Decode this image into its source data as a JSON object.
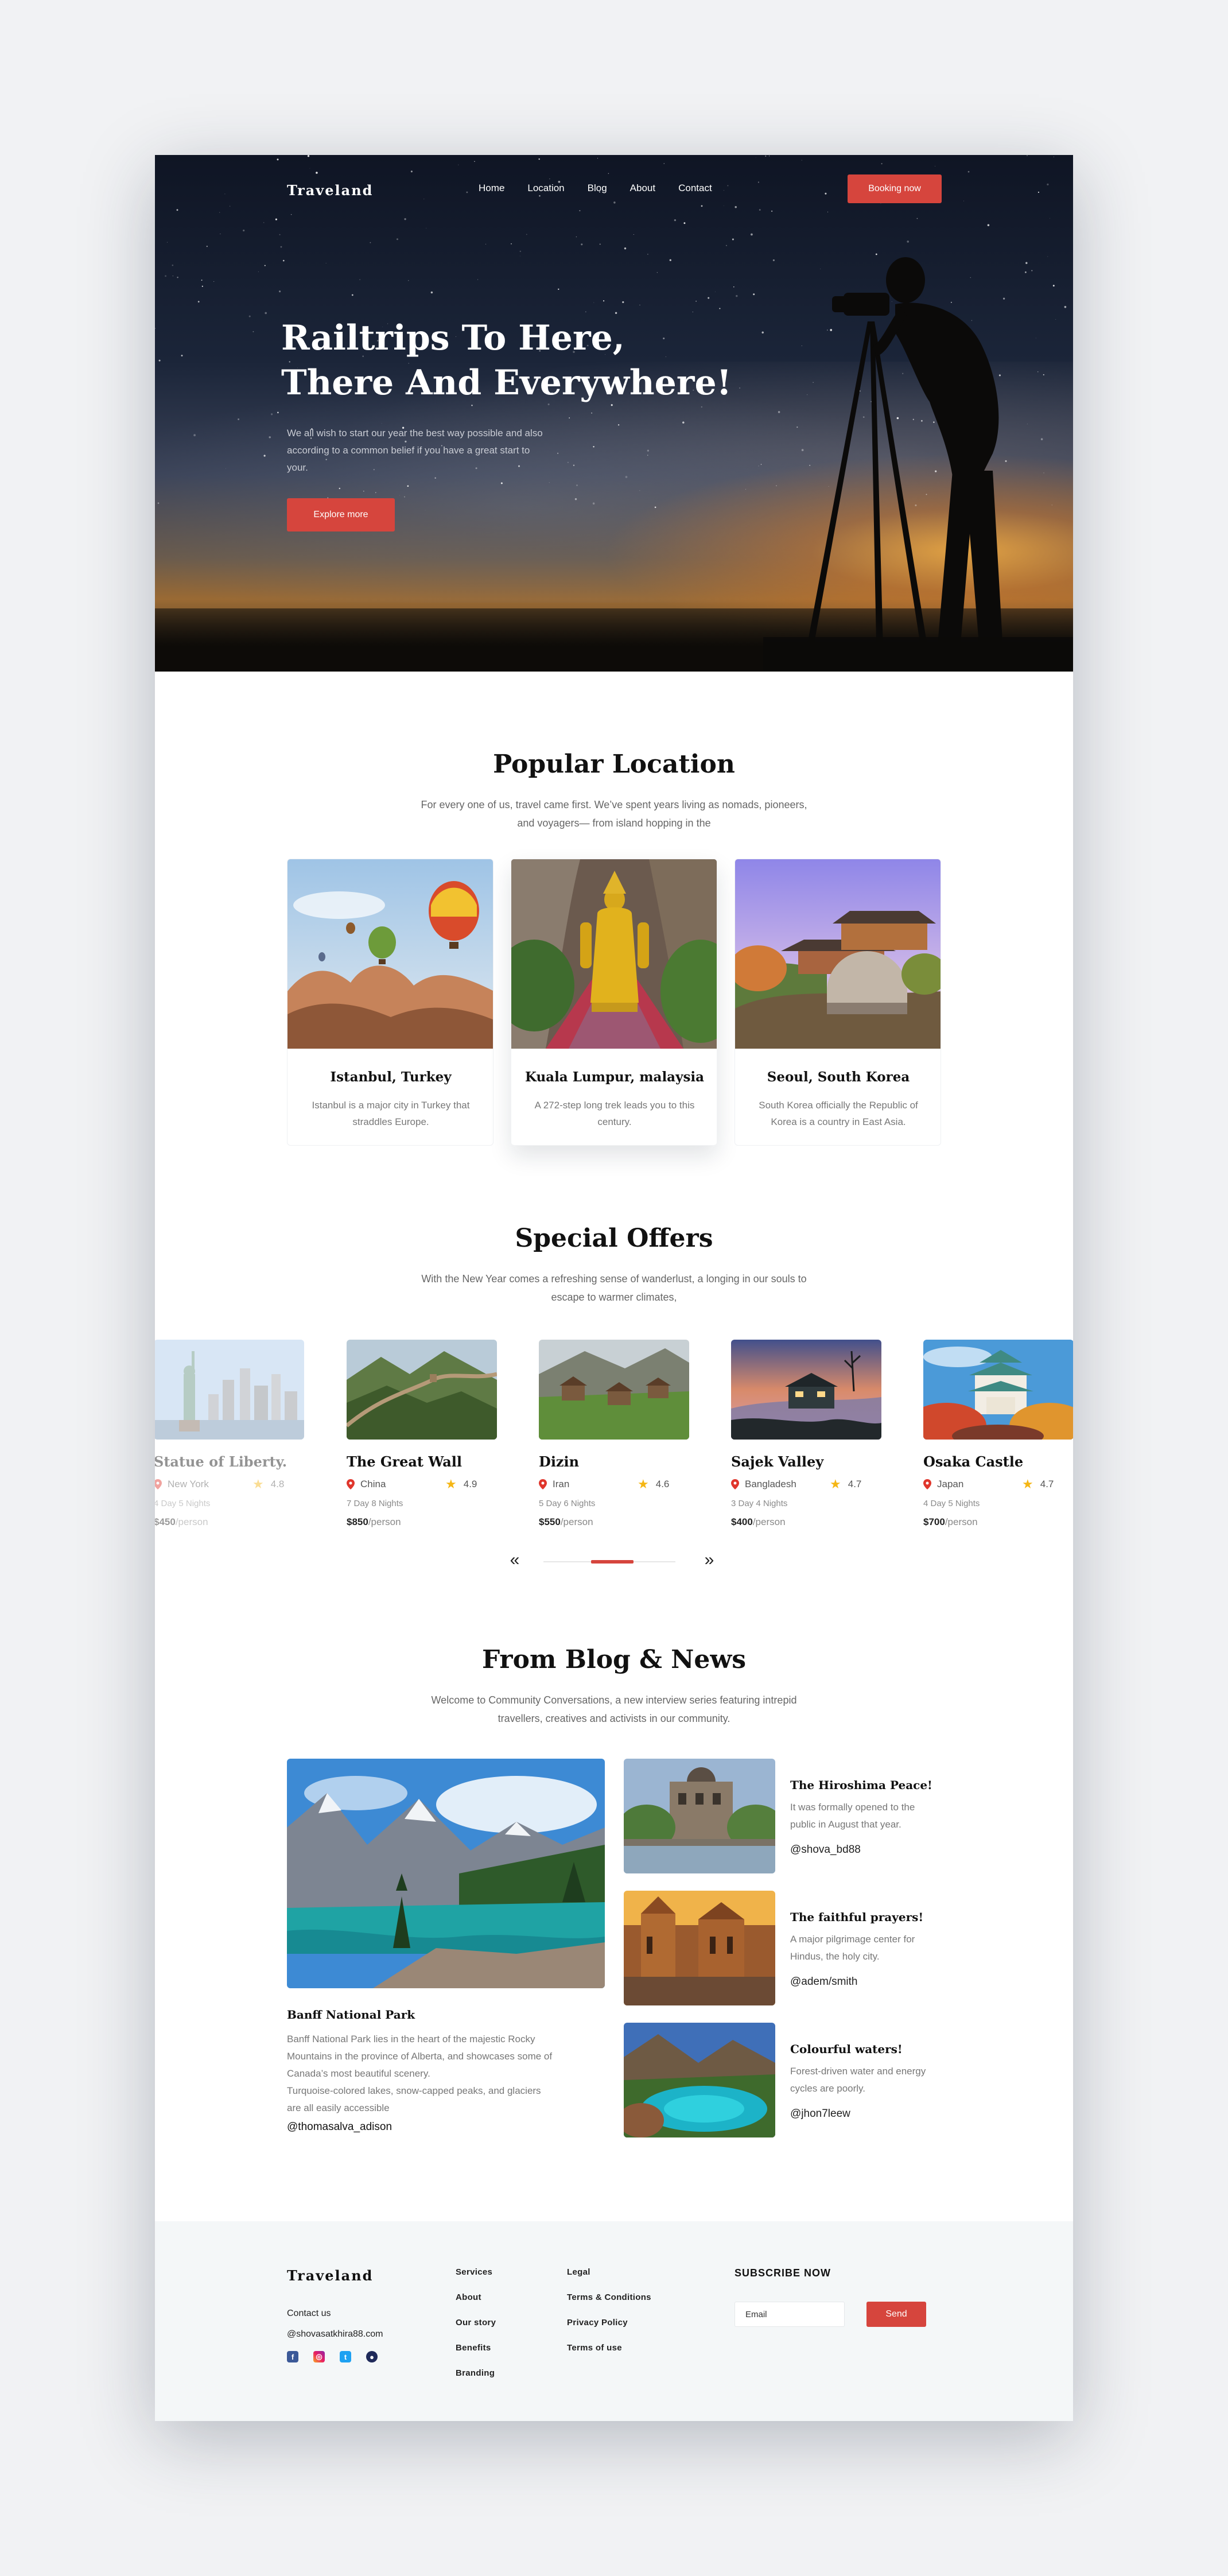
{
  "header": {
    "logo": "Traveland",
    "nav": [
      "Home",
      "Location",
      "Blog",
      "About",
      "Contact"
    ],
    "booking_label": "Booking now"
  },
  "hero": {
    "title": "Railtrips To Here,\nThere And Everywhere!",
    "lead": "We all wish to start our year the best way possible and also according to a common belief if you have a great start to your.",
    "cta": "Explore more"
  },
  "popular": {
    "title": "Popular Location",
    "subtitle": "For every one of us, travel came first. We’ve spent years living as nomads, pioneers, and voyagers— from island hopping in the",
    "cards": [
      {
        "name": "Istanbul, Turkey",
        "desc": "Istanbul is a major city in Turkey that straddles Europe."
      },
      {
        "name": "Kuala Lumpur, malaysia",
        "desc": "A 272-step long trek leads you to this century."
      },
      {
        "name": "Seoul, South Korea",
        "desc": "South Korea officially the Republic of Korea is a country in East Asia."
      }
    ]
  },
  "offers": {
    "title": "Special Offers",
    "subtitle": "With the New Year comes a refreshing sense of wanderlust, a longing in our souls to escape to warmer climates,",
    "items": [
      {
        "title": "Statue of Liberty.",
        "country": "New York",
        "rating": "4.8",
        "nights": "4 Day 5 Nights",
        "price": "$450",
        "per": "/person"
      },
      {
        "title": "The Great Wall",
        "country": "China",
        "rating": "4.9",
        "nights": "7 Day 8 Nights",
        "price": "$850",
        "per": "/person"
      },
      {
        "title": "Dizin",
        "country": "Iran",
        "rating": "4.6",
        "nights": "5 Day 6 Nights",
        "price": "$550",
        "per": "/person"
      },
      {
        "title": "Sajek Valley",
        "country": "Bangladesh",
        "rating": "4.7",
        "nights": "3 Day 4 Nights",
        "price": "$400",
        "per": "/person"
      },
      {
        "title": "Osaka Castle",
        "country": "Japan",
        "rating": "4.7",
        "nights": "4 Day 5 Nights",
        "price": "$700",
        "per": "/person"
      }
    ],
    "prev": "«",
    "next": "»",
    "slider_position": 0.5
  },
  "blog": {
    "title": "From Blog & News",
    "subtitle": "Welcome to Community Conversations, a new interview series featuring intrepid travellers, creatives and activists in our community.",
    "main": {
      "title": "Banff National Park",
      "text": "Banff National Park lies in the heart of the majestic Rocky Mountains in the province of Alberta, and showcases some of Canada’s most beautiful scenery.\nTurquoise-colored lakes, snow-capped peaks, and glaciers are all easily accessible",
      "author": "@thomasalva_adison"
    },
    "side": [
      {
        "title": "The Hiroshima Peace!",
        "text": "It was formally opened to the public in August that year.",
        "author": "@shova_bd88"
      },
      {
        "title": "The faithful prayers!",
        "text": "A major pilgrimage center for Hindus, the holy city.",
        "author": "@adem/smith"
      },
      {
        "title": "Colourful waters!",
        "text": "Forest-driven water and energy cycles are poorly.",
        "author": "@jhon7leew"
      }
    ]
  },
  "footer": {
    "logo": "Traveland",
    "contact_label": "Contact us",
    "contact_email": "@shovasatkhira88.com",
    "col1": [
      "Services",
      "About",
      "Our story",
      "Benefits",
      "Branding"
    ],
    "col2": [
      "Legal",
      "Terms & Conditions",
      "Privacy Policy",
      "Terms of use"
    ],
    "subscribe_title": "SUBSCRIBE NOW",
    "email_placeholder": "Email",
    "send_label": "Send",
    "socials": [
      "facebook-icon",
      "instagram-icon",
      "twitter-icon",
      "dribbble-icon"
    ]
  },
  "colors": {
    "accent": "#d6453d",
    "star": "#f5b614",
    "footer_bg": "#f4f7f8"
  }
}
